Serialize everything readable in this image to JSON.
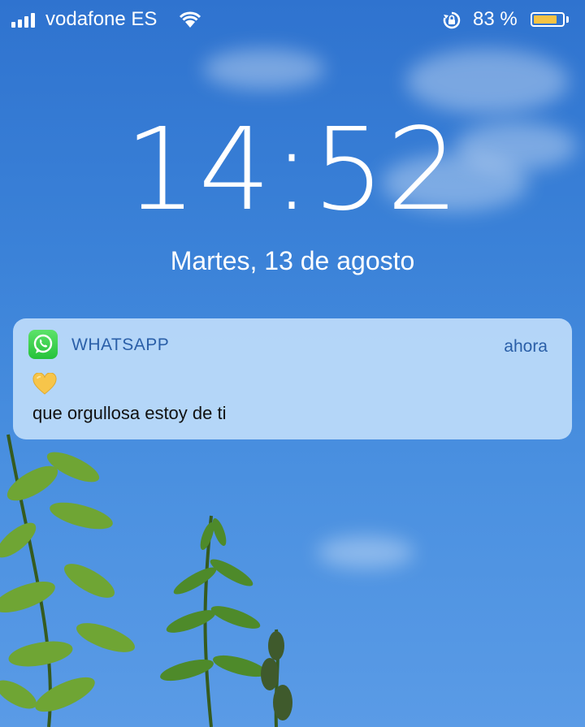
{
  "status_bar": {
    "carrier": "vodafone ES",
    "battery_percent": "83 %",
    "battery_level": 0.83,
    "battery_color": "#f6c343"
  },
  "lock_screen": {
    "time": "14:52",
    "date": "Martes, 13 de agosto"
  },
  "notification": {
    "app_name": "WHATSAPP",
    "time": "ahora",
    "emoji": "yellow-heart-icon",
    "message": "que orgullosa estoy de ti",
    "app_color": "#25c23a"
  }
}
